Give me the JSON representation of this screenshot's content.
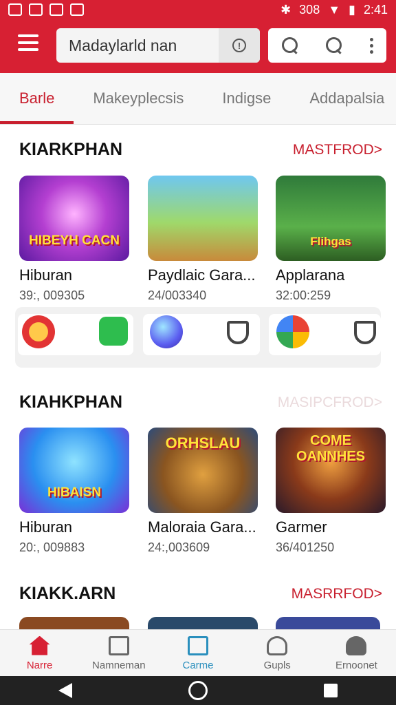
{
  "status": {
    "battery_text": "308",
    "time": "2:41"
  },
  "search": {
    "value": "Madaylarld nan"
  },
  "tabs": [
    "Barle",
    "Makeyplecsis",
    "Indigse",
    "Addapalsia"
  ],
  "sections": [
    {
      "title": "KIARKPHAN",
      "more": "MASTFROD>",
      "cards": [
        {
          "art": "HIBEYH CACN",
          "name": "Hiburan",
          "num": "39:, 009305"
        },
        {
          "art": "",
          "name": "Paydlaic Gara...",
          "num": "24/003340"
        },
        {
          "art": "Flihgas",
          "name": "Applarana",
          "num": "32:00:259"
        }
      ]
    },
    {
      "title": "KIAHKPHAN",
      "more": "MASIPCFROD>",
      "cards": [
        {
          "art": "HIBAISN",
          "name": "Hiburan",
          "num": "20:, 009883"
        },
        {
          "art": "ORHSLAU",
          "name": "Maloraia Gara...",
          "num": "24:,003609"
        },
        {
          "art": "COME OANNHES",
          "name": "Garmer",
          "num": "36/401250"
        }
      ]
    },
    {
      "title": "KIAKK.ARN",
      "more": "MASRRFOD>"
    }
  ],
  "bottom_nav": [
    "Narre",
    "Namneman",
    "Carme",
    "Gupls",
    "Ernoonet"
  ],
  "colors": {
    "accent": "#d72033",
    "active_nav": "#2a8fbd"
  }
}
